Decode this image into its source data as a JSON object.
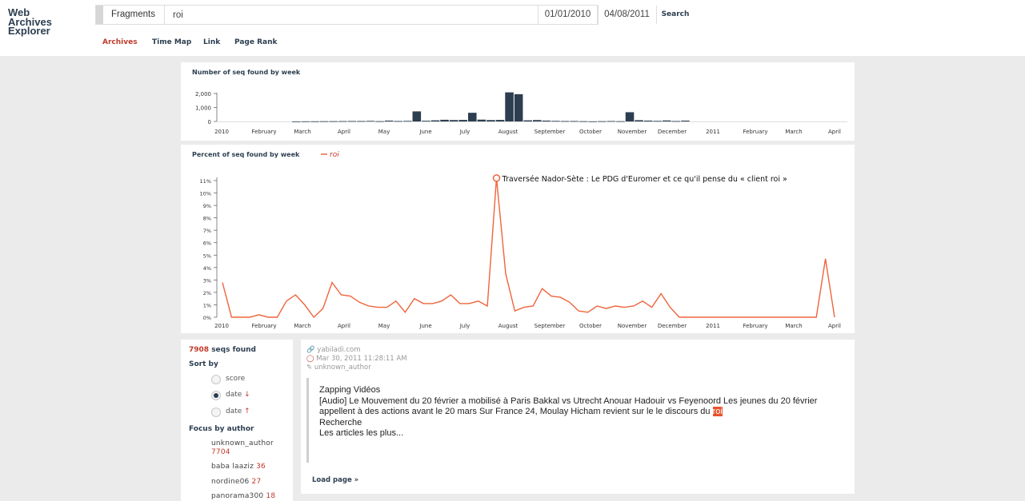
{
  "app": {
    "logo_lines": [
      "Web",
      "Archives",
      "Explorer"
    ]
  },
  "search": {
    "mode": "Fragments",
    "query": "roi",
    "date_start": "01/01/2010",
    "date_end": "04/08/2011",
    "button": "Search"
  },
  "nav": {
    "tabs": [
      {
        "label": "Archives",
        "active": true
      },
      {
        "label": "Time Map",
        "active": false
      },
      {
        "label": "Link",
        "active": false
      },
      {
        "label": "Page Rank",
        "active": false
      }
    ]
  },
  "colors": {
    "accent": "#c0392b",
    "series": "#f0643c",
    "bars": "#2c3e50"
  },
  "chart_data": [
    {
      "type": "bar",
      "title": "Number of seq found by week",
      "ylim": [
        0,
        2000
      ],
      "yticks": [
        "0",
        "1,000",
        "2,000"
      ],
      "x_tick_labels": [
        "2010",
        "February",
        "March",
        "April",
        "May",
        "June",
        "July",
        "August",
        "September",
        "October",
        "November",
        "December",
        "2011",
        "February",
        "March",
        "April"
      ],
      "values": [
        0,
        0,
        0,
        0,
        0,
        0,
        0,
        0,
        5,
        10,
        12,
        18,
        20,
        25,
        30,
        28,
        40,
        20,
        60,
        30,
        40,
        720,
        50,
        80,
        120,
        100,
        110,
        620,
        130,
        100,
        110,
        2080,
        1950,
        80,
        100,
        60,
        40,
        30,
        30,
        20,
        10,
        20,
        30,
        20,
        660,
        90,
        60,
        40,
        70,
        30,
        60,
        0,
        0,
        0,
        0,
        0,
        0,
        0,
        0,
        0,
        0,
        0,
        0,
        0,
        0,
        0,
        0,
        0
      ]
    },
    {
      "type": "line",
      "title": "Percent of seq found by week",
      "legend": [
        "roi"
      ],
      "ylim": [
        0,
        11
      ],
      "yticks": [
        "0%",
        "1%",
        "2%",
        "3%",
        "4%",
        "5%",
        "6%",
        "7%",
        "8%",
        "9%",
        "10%",
        "11%"
      ],
      "x_tick_labels": [
        "2010",
        "February",
        "March",
        "April",
        "May",
        "June",
        "July",
        "August",
        "September",
        "October",
        "November",
        "December",
        "2011",
        "February",
        "March",
        "April"
      ],
      "series": [
        {
          "name": "roi",
          "values": [
            2.8,
            0,
            0,
            0,
            0.2,
            0,
            0,
            1.3,
            1.8,
            1.0,
            0,
            0.7,
            2.8,
            1.8,
            1.7,
            1.2,
            0.9,
            0.8,
            0.8,
            1.3,
            0.4,
            1.5,
            1.1,
            1.1,
            1.3,
            1.8,
            1.1,
            1.1,
            1.3,
            0.9,
            11.2,
            3.5,
            0.5,
            0.8,
            0.9,
            2.3,
            1.7,
            1.6,
            1.2,
            0.5,
            0.4,
            0.9,
            0.7,
            0.9,
            0.8,
            0.9,
            1.3,
            0.8,
            1.9,
            0.8,
            0,
            0,
            0,
            0,
            0,
            0,
            0,
            0,
            0,
            0,
            0,
            0,
            0,
            0,
            0,
            0,
            4.7,
            0
          ]
        }
      ],
      "annotation": "Traversée Nador-Sète : Le PDG d'Euromer et ce qu'il pense du « client roi »"
    }
  ],
  "sidebar": {
    "count": "7908",
    "count_label": "seqs found",
    "sort_label": "Sort by",
    "sort_options": [
      {
        "label": "score",
        "arrow": "",
        "checked": false
      },
      {
        "label": "date",
        "arrow": "↓",
        "checked": true
      },
      {
        "label": "date",
        "arrow": "↑",
        "checked": false
      }
    ],
    "focus_label": "Focus by author",
    "authors": [
      {
        "name": "unknown_author",
        "count": "7704"
      },
      {
        "name": "baba laaziz",
        "count": "36"
      },
      {
        "name": "nordine06",
        "count": "27"
      },
      {
        "name": "panorama300",
        "count": "18"
      }
    ]
  },
  "result": {
    "domain": "yabiladi.com",
    "date": "Mar 30, 2011 11:28:11 AM",
    "author": "unknown_author",
    "lines": [
      "Zapping Vidéos",
      "[Audio] Le Mouvement du 20 février a mobilisé à Paris Bakkal vs Utrecht Anouar Hadouir vs Feyenoord Les jeunes du 20 février appellent à des actions avant le 20 mars Sur France 24, Moulay Hicham revient sur le le discours du",
      "roi",
      "Recherche",
      "Les articles les plus..."
    ],
    "load_page": "Load page »"
  }
}
